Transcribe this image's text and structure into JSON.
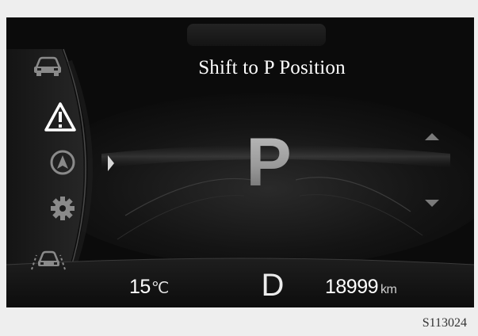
{
  "cluster": {
    "message": "Shift to P Position",
    "current_gear": "P",
    "selected_gear": "D",
    "temperature": {
      "value": "15",
      "unit": "℃"
    },
    "odometer": {
      "value": "18999",
      "unit": "km"
    },
    "sidebar": {
      "items": [
        {
          "icon": "car-icon",
          "active": false
        },
        {
          "icon": "warning-icon",
          "active": true
        },
        {
          "icon": "navigation-icon",
          "active": false
        },
        {
          "icon": "settings-icon",
          "active": false
        },
        {
          "icon": "driver-assist-icon",
          "active": false
        }
      ]
    }
  },
  "figure_code": "S113024",
  "colors": {
    "screen_bg": "#0b0b0b",
    "text": "#ffffff",
    "gear_p": "#9a9a9a",
    "page_bg": "#eeeeee"
  }
}
